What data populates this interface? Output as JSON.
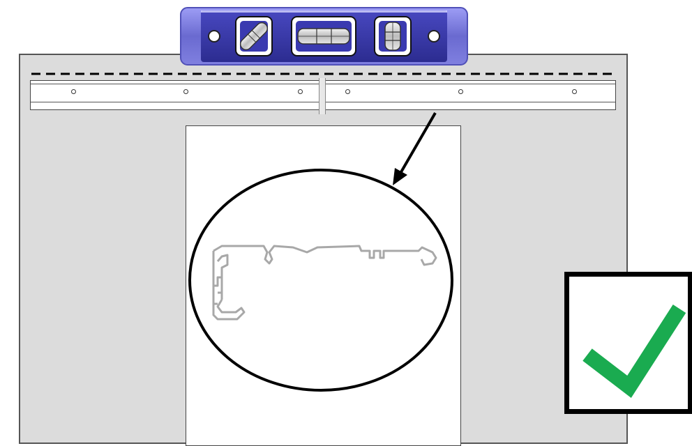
{
  "diagram": {
    "colors": {
      "background": "#ffffff",
      "wall": "#dcdcdc",
      "panel": "#ffffff",
      "outline": "#000000",
      "level_body": "#6a6ad0",
      "level_frame": "#8d8df0",
      "level_window": "#3a3ab0",
      "profile": "#b5b5b5",
      "checkmark": "#1aab50"
    },
    "icons": {
      "level_tool": "spirit-level-icon",
      "diagonal_vial": "diagonal-bubble-vial-icon",
      "horizontal_vial": "horizontal-bubble-vial-icon",
      "vertical_vial": "vertical-bubble-vial-icon",
      "checkmark": "checkmark-icon",
      "arrow": "arrow-icon"
    },
    "rail_hole_count": 6,
    "status": "correct"
  }
}
